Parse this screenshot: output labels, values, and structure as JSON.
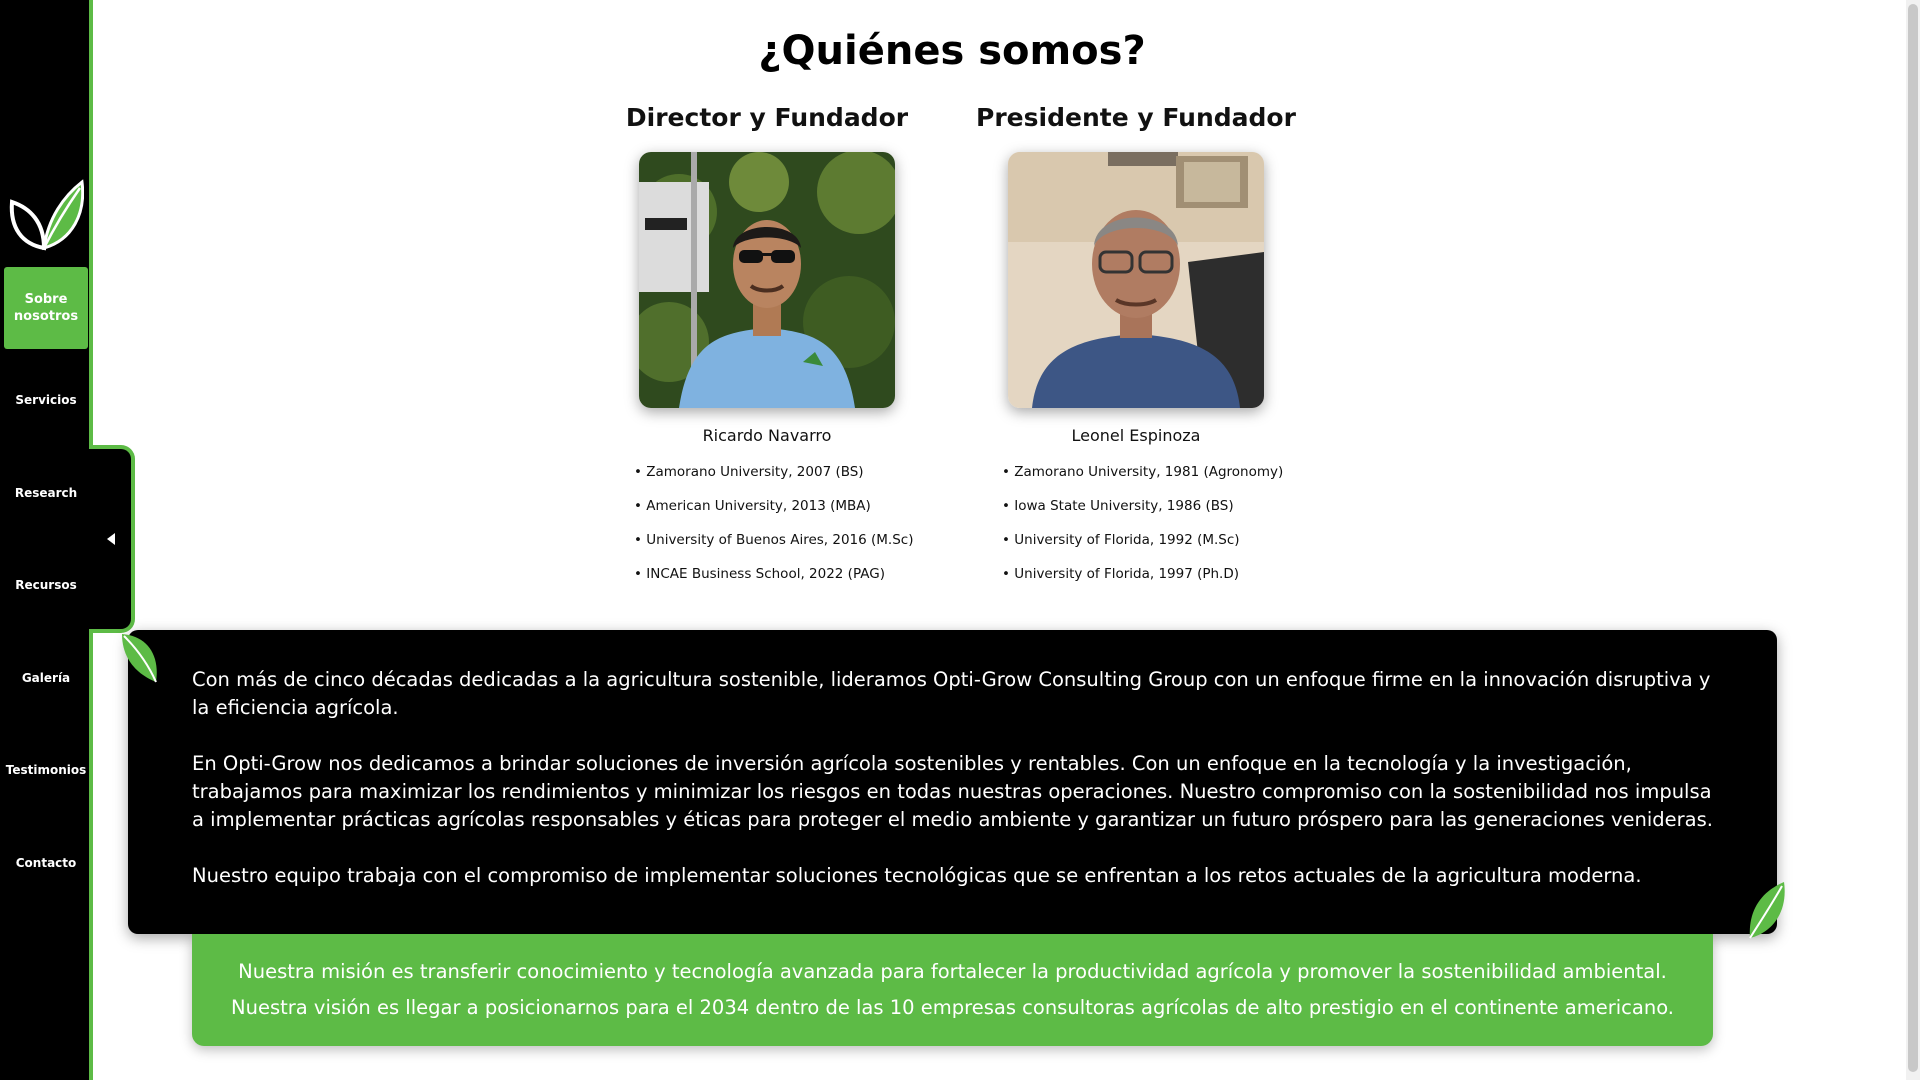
{
  "nav": {
    "items": [
      {
        "label": "Sobre nosotros",
        "active": true
      },
      {
        "label": "Servicios"
      },
      {
        "label": "Research"
      },
      {
        "label": "Recursos"
      },
      {
        "label": "Galería"
      },
      {
        "label": "Testimonios"
      },
      {
        "label": "Contacto"
      }
    ]
  },
  "page": {
    "title": "¿Quiénes somos?"
  },
  "people": [
    {
      "role": "Director y Fundador",
      "name": "Ricardo Navarro",
      "credentials": [
        "• Zamorano University, 2007 (BS)",
        "• American University, 2013 (MBA)",
        "• University of Buenos Aires, 2016 (M.Sc)",
        "• INCAE Business School, 2022 (PAG)"
      ]
    },
    {
      "role": "Presidente y Fundador",
      "name": "Leonel Espinoza",
      "credentials": [
        "• Zamorano University, 1981 (Agronomy)",
        "• Iowa State University, 1986 (BS)",
        "• University of Florida, 1992 (M.Sc)",
        "• University of Florida, 1997 (Ph.D)"
      ]
    }
  ],
  "about": {
    "paragraphs": [
      "Con más de cinco décadas dedicadas a la agricultura sostenible, lideramos Opti-Grow Consulting Group con un enfoque firme en la innovación disruptiva y la eficiencia agrícola.",
      "En Opti-Grow nos dedicamos a brindar soluciones de inversión agrícola sostenibles y rentables. Con un enfoque en la tecnología y la investigación, trabajamos para maximizar los rendimientos y minimizar los riesgos en todas nuestras operaciones. Nuestro compromiso con la sostenibilidad nos impulsa a implementar prácticas agrícolas responsables y éticas para proteger el medio ambiente y garantizar un futuro próspero para las generaciones venideras.",
      "Nuestro equipo trabaja con el compromiso de implementar soluciones tecnológicas que se enfrentan a los retos actuales de la agricultura moderna."
    ]
  },
  "mission": {
    "mission_text": "Nuestra misión es transferir conocimiento y tecnología avanzada para fortalecer la productividad agrícola y promover la sostenibilidad ambiental.",
    "vision_text": "Nuestra visión es llegar a posicionarnos para el 2034 dentro de las 10 empresas consultoras agrícolas de alto prestigio en el continente americano."
  },
  "colors": {
    "brand_green": "#5dbb46",
    "sidebar_bg": "#000000"
  },
  "icons": {
    "logo": "leaf-logo-icon",
    "collapse": "caret-left-icon",
    "decor": "leaf-icon"
  }
}
